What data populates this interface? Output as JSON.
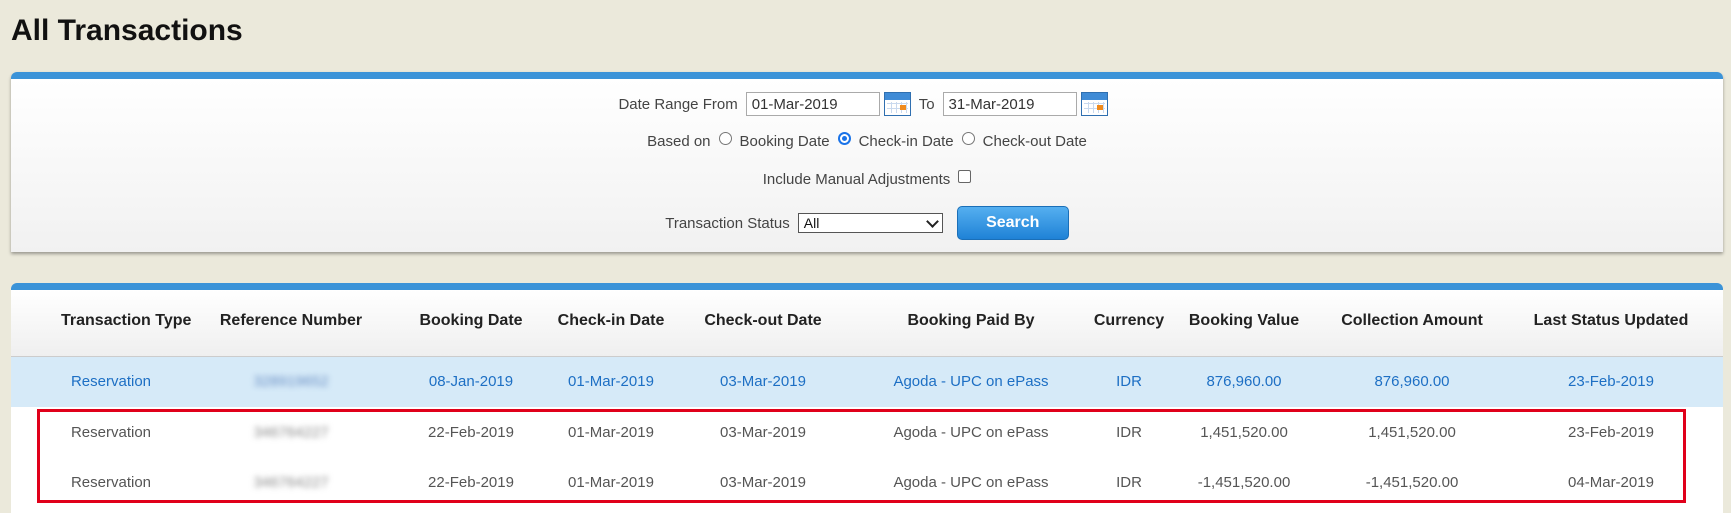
{
  "page_title": "All Transactions",
  "filters": {
    "date_range_label": "Date Range From",
    "date_from": "01-Mar-2019",
    "to_label": "To",
    "date_to": "31-Mar-2019",
    "based_on_label": "Based on",
    "based_on_options": [
      "Booking Date",
      "Check-in Date",
      "Check-out Date"
    ],
    "based_on_selected": "Check-in Date",
    "include_manual_label": "Include Manual Adjustments",
    "include_manual_checked": false,
    "status_label": "Transaction Status",
    "status_value": "All",
    "search_label": "Search"
  },
  "table": {
    "columns": [
      "Transaction Type",
      "Reference Number",
      "Booking Date",
      "Check-in Date",
      "Check-out Date",
      "Booking Paid By",
      "Currency",
      "Booking Value",
      "Collection Amount",
      "Last Status Updated"
    ],
    "rows": [
      [
        "Reservation",
        "328919652",
        "08-Jan-2019",
        "01-Mar-2019",
        "03-Mar-2019",
        "Agoda - UPC on ePass",
        "IDR",
        "876,960.00",
        "876,960.00",
        "23-Feb-2019"
      ],
      [
        "Reservation",
        "346764227",
        "22-Feb-2019",
        "01-Mar-2019",
        "03-Mar-2019",
        "Agoda - UPC on ePass",
        "IDR",
        "1,451,520.00",
        "1,451,520.00",
        "23-Feb-2019"
      ],
      [
        "Reservation",
        "346764227",
        "22-Feb-2019",
        "01-Mar-2019",
        "03-Mar-2019",
        "Agoda - UPC on ePass",
        "IDR",
        "-1,451,520.00",
        "-1,451,520.00",
        "04-Mar-2019"
      ]
    ]
  },
  "colors": {
    "accent": "#3b93d8",
    "selected_row": "#d6eaf8",
    "highlight_border": "#e0001a"
  }
}
